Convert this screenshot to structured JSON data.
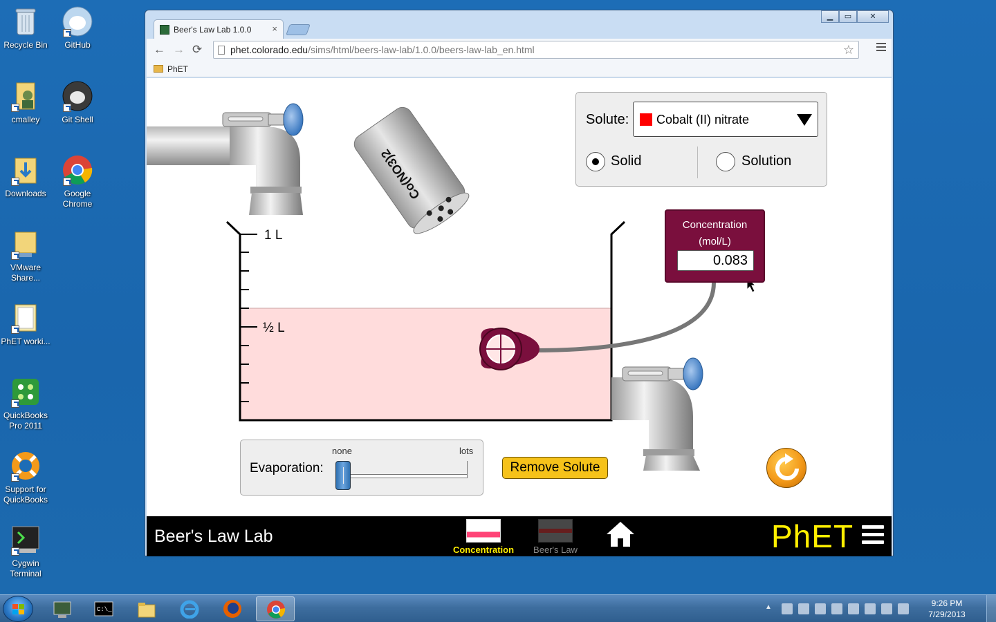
{
  "desktop": {
    "icons": [
      {
        "label": "Recycle Bin"
      },
      {
        "label": "GitHub"
      },
      {
        "label": "cmalley"
      },
      {
        "label": "Git Shell"
      },
      {
        "label": "Downloads"
      },
      {
        "label": "Google Chrome"
      },
      {
        "label": "VMware Share..."
      },
      {
        "label": "PhET worki..."
      },
      {
        "label": "QuickBooks Pro 2011"
      },
      {
        "label": "Support for QuickBooks"
      },
      {
        "label": "Cygwin Terminal"
      }
    ]
  },
  "browser": {
    "tab_title": "Beer's Law Lab 1.0.0",
    "tab_close": "×",
    "url_host": "phet.colorado.edu",
    "url_path": "/sims/html/beers-law-lab/1.0.0/beers-law-lab_en.html",
    "bookmark": "PhET",
    "nav_back": "←",
    "nav_forward": "→",
    "nav_reload": "⟳",
    "star": "☆",
    "controls": {
      "minimize": "▁",
      "maximize": "▭",
      "close": "✕"
    }
  },
  "sim": {
    "shaker_label": "Co(NO3)2",
    "beaker": {
      "mark_full": "1 L",
      "mark_half": "½ L"
    },
    "solute_panel": {
      "label": "Solute:",
      "selected": "Cobalt (II) nitrate",
      "swatch_color": "#ff0000",
      "mode_solid": "Solid",
      "mode_solution": "Solution",
      "selected_mode": "Solid"
    },
    "meter": {
      "title_line1": "Concentration",
      "title_line2": "(mol/L)",
      "value": "0.083"
    },
    "evaporation": {
      "label": "Evaporation:",
      "min_label": "none",
      "max_label": "lots",
      "level": 0
    },
    "remove_solute": "Remove Solute",
    "solution_color": "#ffdcdc",
    "solution_volume_fraction": 0.6
  },
  "footer": {
    "title": "Beer's Law Lab",
    "screens": [
      {
        "label": "Concentration",
        "active": true
      },
      {
        "label": "Beer's Law",
        "active": false
      }
    ],
    "logo": "PhET"
  },
  "taskbar": {
    "clock_time": "9:26 PM",
    "clock_date": "7/29/2013"
  }
}
